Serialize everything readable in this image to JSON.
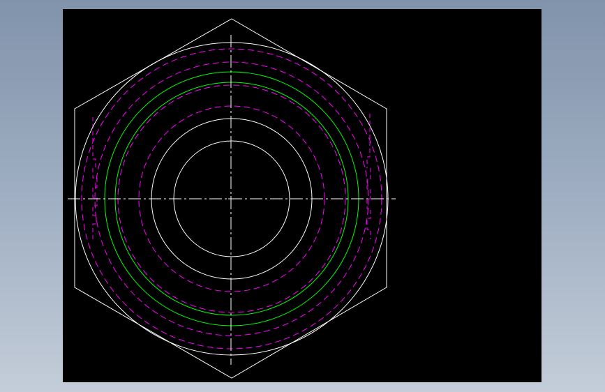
{
  "drawing": {
    "subject": "hex-nut-top-view",
    "background": "#000000",
    "colors": {
      "outline": "#ffffff",
      "thread": "#00ff00",
      "hidden": "#ff00ff",
      "centerline": "#ffffff",
      "backdrop_top": "#8193ab",
      "backdrop_bottom": "#c4cdd9"
    },
    "line_styles": {
      "outline": "solid",
      "thread": "solid",
      "hidden": "dashed",
      "centerline": "dash-dot"
    }
  }
}
